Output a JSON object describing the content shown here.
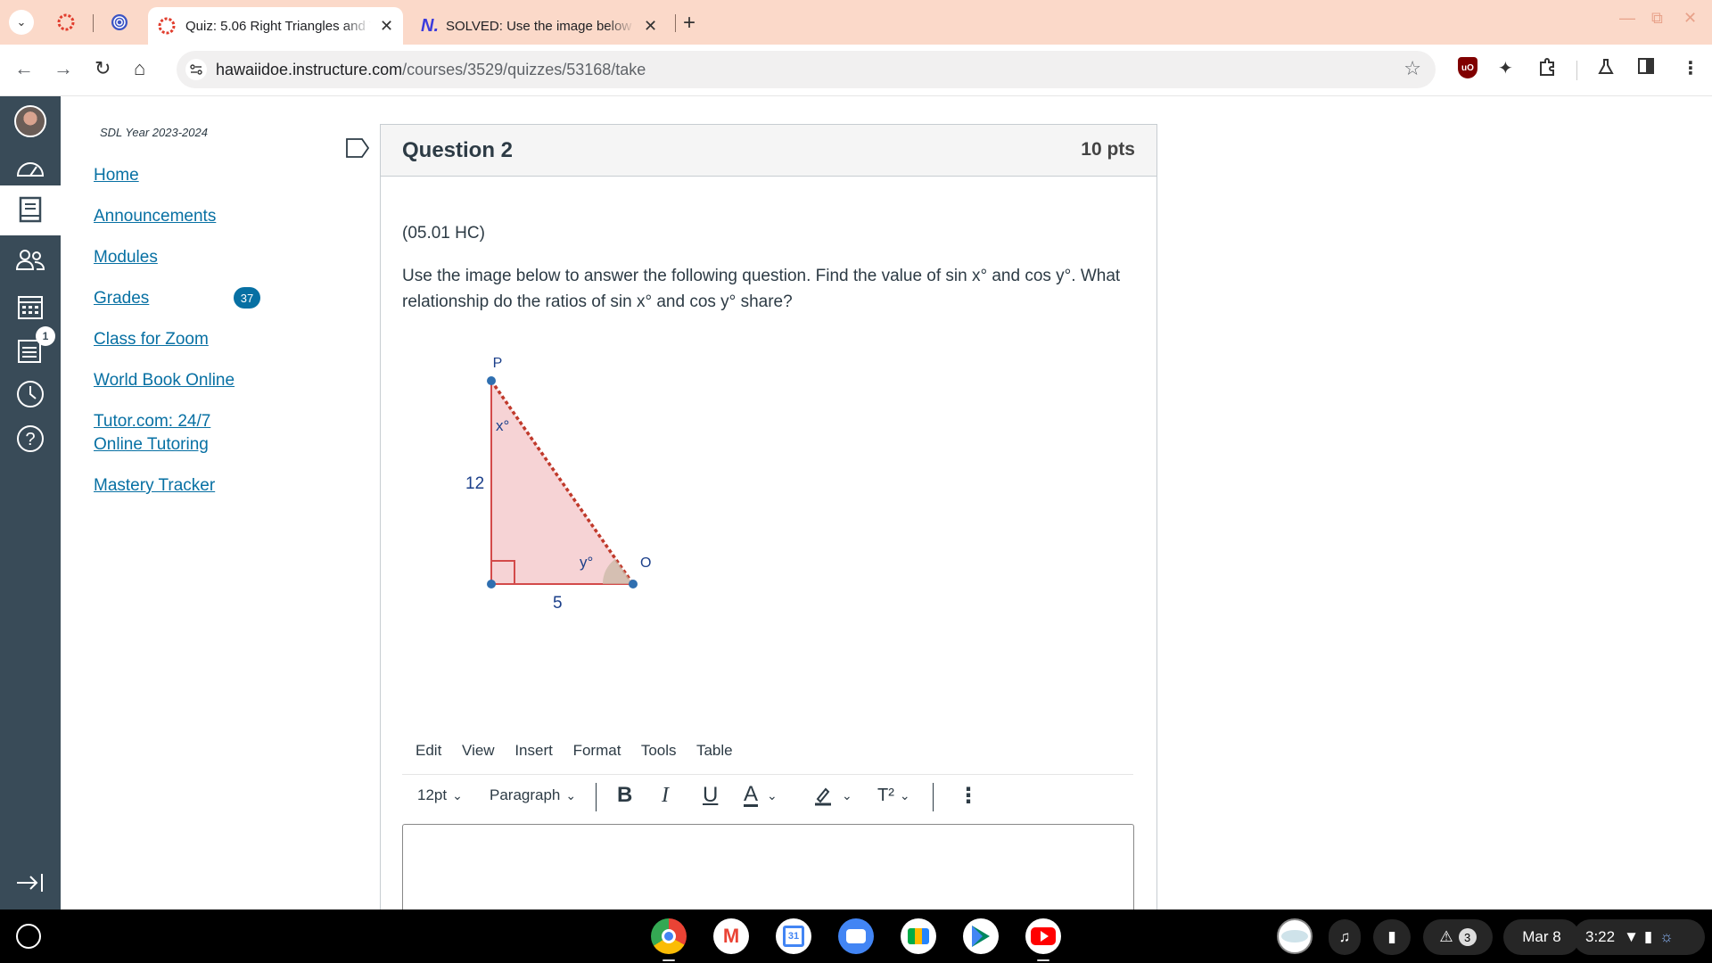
{
  "browser": {
    "tabs": [
      {
        "title": "Quiz: 5.06 Right Triangles and T",
        "active": true
      },
      {
        "title": "SOLVED: Use the image below a",
        "active": false
      }
    ],
    "url_host": "hawaiidoe.instructure.com",
    "url_path": "/courses/3529/quizzes/53168/take"
  },
  "global_nav": {
    "inbox_badge": "1"
  },
  "course_nav": {
    "term": "SDL Year 2023-2024",
    "links": [
      {
        "label": "Home"
      },
      {
        "label": "Announcements"
      },
      {
        "label": "Modules"
      },
      {
        "label": "Grades",
        "badge": "37"
      },
      {
        "label": "Class for Zoom"
      },
      {
        "label": "World Book Online"
      },
      {
        "label": "Tutor.com: 24/7 Online Tutoring"
      },
      {
        "label": "Mastery Tracker"
      }
    ]
  },
  "question": {
    "title": "Question 2",
    "points": "10 pts",
    "code": "(05.01 HC)",
    "text": "Use the image below to answer the following question. Find the value of sin x° and cos y°. What relationship do the ratios of sin x° and cos y° share?",
    "figure": {
      "vertex_top": "P",
      "vertex_right": "O",
      "side_vertical": "12",
      "side_horizontal": "5",
      "angle_top": "x°",
      "angle_right": "y°"
    }
  },
  "editor": {
    "menu": [
      "Edit",
      "View",
      "Insert",
      "Format",
      "Tools",
      "Table"
    ],
    "font_size": "12pt",
    "block_format": "Paragraph",
    "bold": "B",
    "italic": "I",
    "underline": "U",
    "text_color": "A",
    "superscript": "T²"
  },
  "shelf": {
    "notification_count": "3",
    "date": "Mar 8",
    "time": "3:22"
  },
  "colors": {
    "canvas_nav": "#394b58",
    "link": "#0770a3",
    "tabstrip": "#fbd9c9",
    "triangle_fill": "#f6d3d5",
    "triangle_edge": "#d34a4a",
    "vertex": "#2f6fb0"
  }
}
